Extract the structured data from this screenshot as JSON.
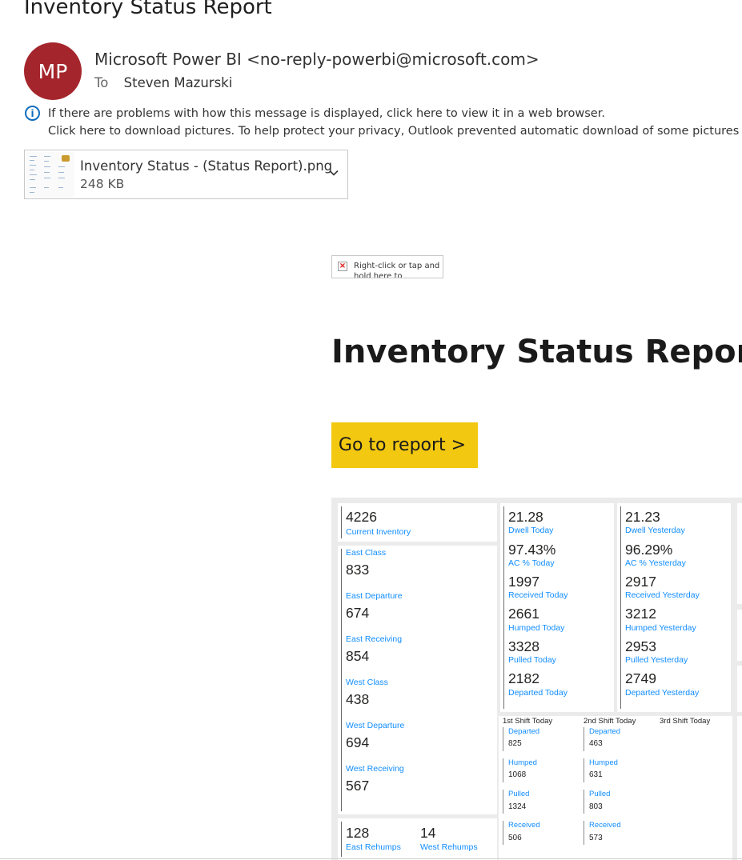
{
  "email": {
    "subject": "Inventory Status Report",
    "avatar_initials": "MP",
    "avatar_color": "#a4262c",
    "sender": "Microsoft Power BI <no-reply-powerbi@microsoft.com>",
    "to_label": "To",
    "to_name": "Steven Mazurski",
    "info_line1": "If there are problems with how this message is displayed, click here to view it in a web browser.",
    "info_line2": "Click here to download pictures. To help protect your privacy, Outlook prevented automatic download of some pictures in this"
  },
  "attachment": {
    "name": "Inventory Status - (Status Report).png",
    "size": "248 KB",
    "icon": "chevron-down-icon"
  },
  "broken_image_text": "Right-click or tap and hold here to download",
  "body": {
    "title": "Inventory Status Report",
    "button_label": "Go to report >",
    "button_color": "#f2c811"
  },
  "dashboard": {
    "current_inventory": {
      "value": "4226",
      "label": "Current Inventory"
    },
    "yards": [
      {
        "label": "East Class",
        "value": "833"
      },
      {
        "label": "East Departure",
        "value": "674"
      },
      {
        "label": "East Receiving",
        "value": "854"
      },
      {
        "label": "West Class",
        "value": "438"
      },
      {
        "label": "West Departure",
        "value": "694"
      },
      {
        "label": "West Receiving",
        "value": "567"
      }
    ],
    "rehumps": [
      {
        "value": "128",
        "label": "East Rehumps"
      },
      {
        "value": "14",
        "label": "West Rehumps"
      }
    ],
    "today": [
      {
        "value": "21.28",
        "label": "Dwell Today"
      },
      {
        "value": "97.43%",
        "label": "AC % Today"
      },
      {
        "value": "1997",
        "label": "Received Today"
      },
      {
        "value": "2661",
        "label": "Humped Today"
      },
      {
        "value": "3328",
        "label": "Pulled Today"
      },
      {
        "value": "2182",
        "label": "Departed Today"
      }
    ],
    "yesterday": [
      {
        "value": "21.23",
        "label": "Dwell Yesterday"
      },
      {
        "value": "96.29%",
        "label": "AC % Yesterday"
      },
      {
        "value": "2917",
        "label": "Received Yesterday"
      },
      {
        "value": "3212",
        "label": "Humped Yesterday"
      },
      {
        "value": "2953",
        "label": "Pulled Yesterday"
      },
      {
        "value": "2749",
        "label": "Departed Yesterday"
      }
    ],
    "shifts": {
      "headers": [
        "1st Shift Today",
        "2nd Shift Today",
        "3rd Shift Today"
      ],
      "first": [
        {
          "label": "Departed",
          "value": "825"
        },
        {
          "label": "Humped",
          "value": "1068"
        },
        {
          "label": "Pulled",
          "value": "1324"
        },
        {
          "label": "Received",
          "value": "506"
        }
      ],
      "second": [
        {
          "label": "Departed",
          "value": "463"
        },
        {
          "label": "Humped",
          "value": "631"
        },
        {
          "label": "Pulled",
          "value": "803"
        },
        {
          "label": "Received",
          "value": "573"
        }
      ]
    },
    "label_color": "#118dff"
  }
}
